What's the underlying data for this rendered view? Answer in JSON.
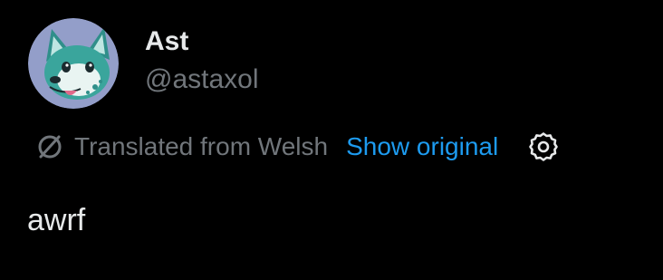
{
  "author": {
    "display_name": "Ast",
    "handle": "@astaxol",
    "avatar_icon": "fursona-avatar"
  },
  "translation": {
    "icon": "translate-icon",
    "label": "Translated from Welsh",
    "show_original_label": "Show original",
    "settings_icon": "gear-icon"
  },
  "post": {
    "text": "awrf"
  },
  "colors": {
    "background": "#000000",
    "primary_text": "#e7e9ea",
    "secondary_text": "#71767b",
    "link": "#1d9bf0"
  }
}
